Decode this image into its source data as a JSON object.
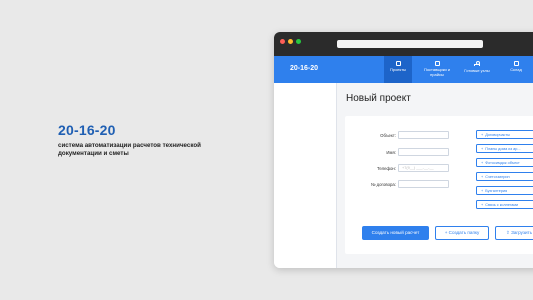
{
  "brand": {
    "title": "20-16-20",
    "subtitle": "система автоматизации расчетов технической документации и сметы"
  },
  "app": {
    "logo": "20-16-20",
    "nav": [
      {
        "label": "Проекты",
        "icon": "projects-icon",
        "active": true
      },
      {
        "label": "Поставщики и прайсы",
        "icon": "suppliers-icon",
        "active": false
      },
      {
        "label": "Готовые узлы",
        "icon": "tree-icon",
        "active": false
      },
      {
        "label": "Склад",
        "icon": "warehouse-icon",
        "active": false
      }
    ]
  },
  "page": {
    "title": "Новый проект"
  },
  "form": {
    "object_label": "Объект:",
    "name_label": "Имя:",
    "phone_label": "Телефон:",
    "phone_placeholder": "+7(9__) ___-__-__",
    "contract_label": "№ договора:"
  },
  "side_buttons": [
    "Договорчасты",
    "Планы дома из ар...",
    "Фотосимдок объект",
    "Счетсхзиприн",
    "Бухгалтерия",
    "Связь с коллегами"
  ],
  "actions": {
    "create_calc": "Создать новый расчет",
    "create_folder": "Создать папку",
    "upload": "Загрузить"
  },
  "colors": {
    "accent": "#2f80ed",
    "brand_text": "#1f5fb3",
    "titlebar": "#2b2b2b"
  }
}
